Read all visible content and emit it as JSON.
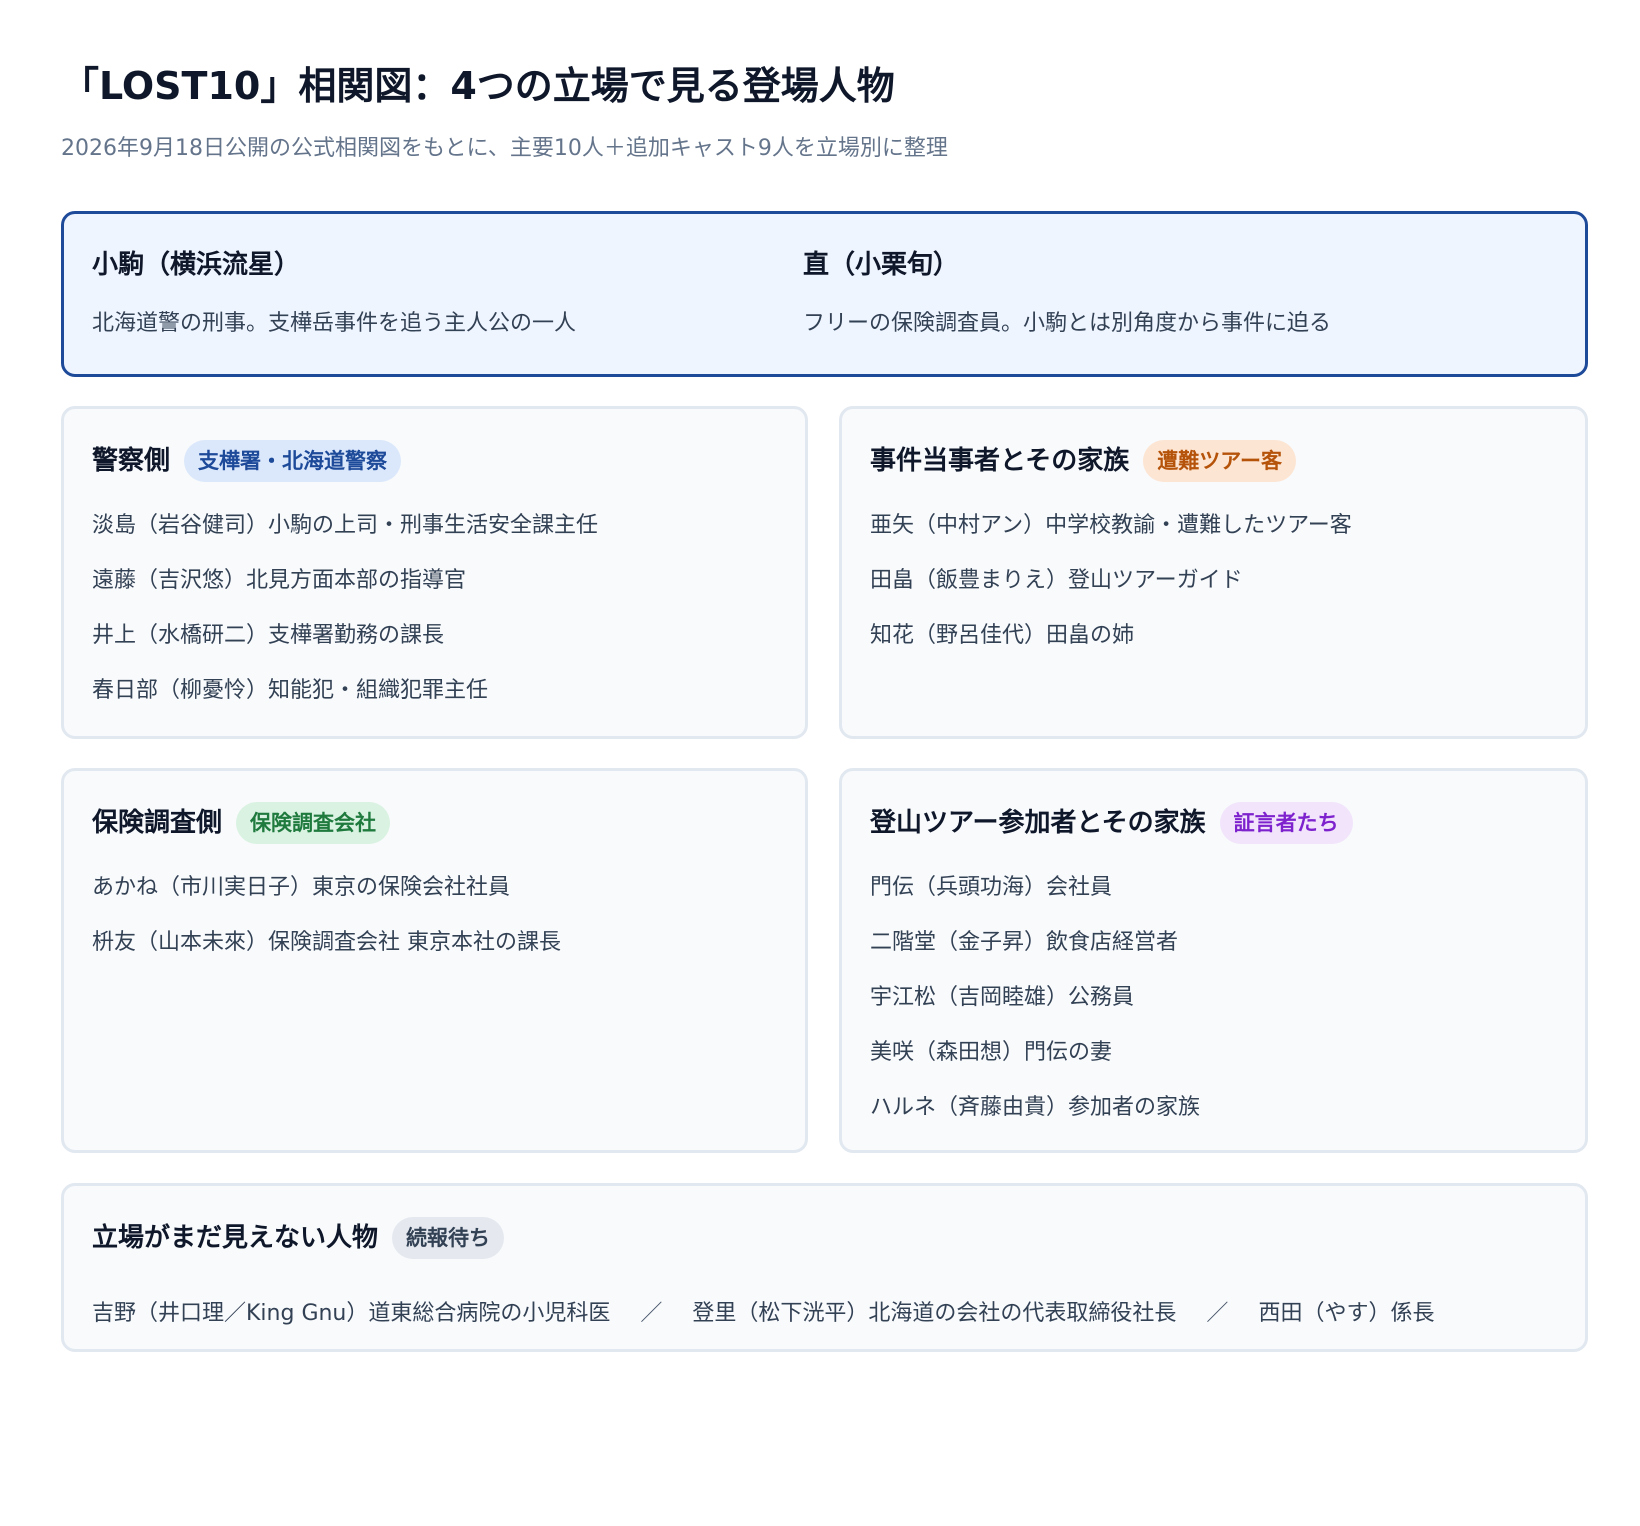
{
  "header": {
    "title": "「LOST10」相関図：4つの立場で見る登場人物",
    "subtitle": "2026年9月18日公開の公式相関図をもとに、主要10人＋追加キャスト9人を立場別に整理"
  },
  "leads": [
    {
      "name": "小駒（横浜流星）",
      "desc": "北海道警の刑事。支樺岳事件を追う主人公の一人"
    },
    {
      "name": "直（小栗旬）",
      "desc": "フリーの保険調査員。小駒とは別角度から事件に迫る"
    }
  ],
  "groups": {
    "police": {
      "title": "警察側",
      "badge": "支樺署・北海道警察",
      "members": [
        "淡島（岩谷健司）小駒の上司・刑事生活安全課主任",
        "遠藤（吉沢悠）北見方面本部の指導官",
        "井上（水橋研二）支樺署勤務の課長",
        "春日部（柳憂怜）知能犯・組織犯罪主任"
      ]
    },
    "incident": {
      "title": "事件当事者とその家族",
      "badge": "遭難ツアー客",
      "members": [
        "亜矢（中村アン）中学校教諭・遭難したツアー客",
        "田畠（飯豊まりえ）登山ツアーガイド",
        "知花（野呂佳代）田畠の姉"
      ]
    },
    "insurance": {
      "title": "保険調査側",
      "badge": "保険調査会社",
      "members": [
        "あかね（市川実日子）東京の保険会社社員",
        "枡友（山本未來）保険調査会社 東京本社の課長"
      ]
    },
    "tour": {
      "title": "登山ツアー参加者とその家族",
      "badge": "証言者たち",
      "members": [
        "門伝（兵頭功海）会社員",
        "二階堂（金子昇）飲食店経営者",
        "宇江松（吉岡睦雄）公務員",
        "美咲（森田想）門伝の妻",
        "ハルネ（斉藤由貴）参加者の家族"
      ]
    }
  },
  "unknown": {
    "title": "立場がまだ見えない人物",
    "badge": "続報待ち",
    "separator": "／",
    "members": [
      "吉野（井口理／King Gnu）道東総合病院の小児科医",
      "登里（松下洸平）北海道の会社の代表取締役社長",
      "西田（やす）係長"
    ]
  }
}
